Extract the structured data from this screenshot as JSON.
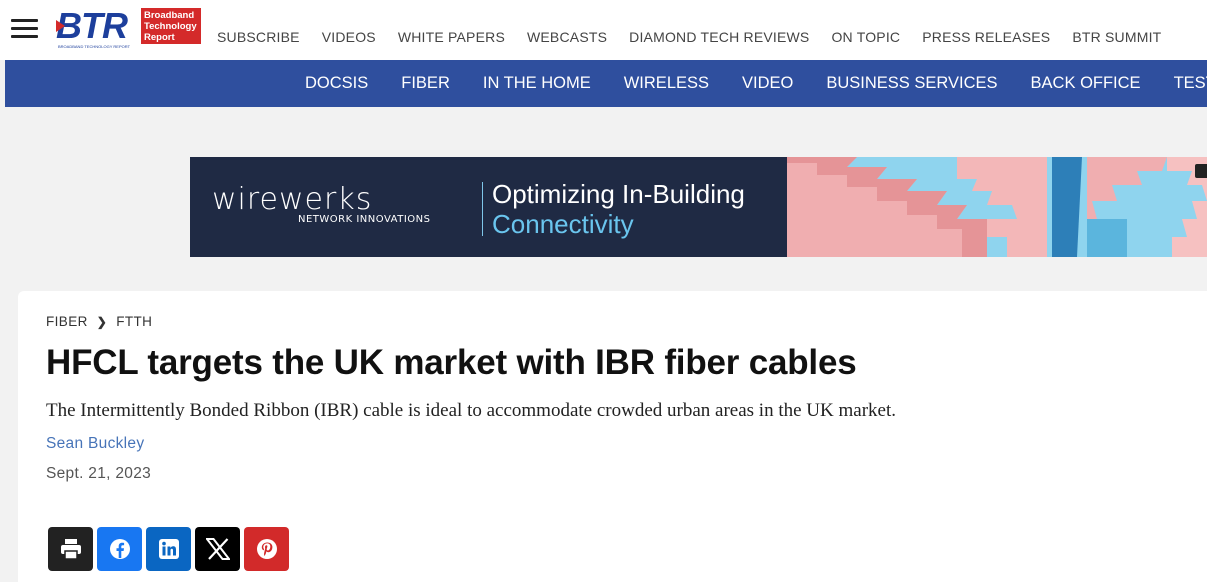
{
  "header": {
    "menu_icon": "hamburger-icon",
    "logo": {
      "wordmark": "BTR",
      "box_line1": "Broadband",
      "box_line2": "Technology",
      "box_line3": "Report",
      "tagline": "BROADBAND TECHNOLOGY REPORT"
    },
    "top_links": [
      "SUBSCRIBE",
      "VIDEOS",
      "WHITE PAPERS",
      "WEBCASTS",
      "DIAMOND TECH REVIEWS",
      "ON TOPIC",
      "PRESS RELEASES",
      "BTR SUMMIT"
    ]
  },
  "main_nav": {
    "items": [
      "DOCSIS",
      "FIBER",
      "IN THE HOME",
      "WIRELESS",
      "VIDEO",
      "BUSINESS SERVICES",
      "BACK OFFICE",
      "TEST"
    ]
  },
  "ad": {
    "brand": "wirewerks",
    "brand_sub": "NETWORK INNOVATIONS",
    "headline_line1": "Optimizing In-Building",
    "headline_line2": "Connectivity",
    "close_icon": "ad-choices-icon"
  },
  "article": {
    "breadcrumb": [
      "FIBER",
      "FTTH"
    ],
    "breadcrumb_sep_icon": "chevron-right-icon",
    "title": "HFCL targets the UK market with IBR fiber cables",
    "subtitle": "The Intermittently Bonded Ribbon (IBR) cable is ideal to accommodate crowded urban areas in the UK market.",
    "author": "Sean Buckley",
    "date": "Sept. 21, 2023"
  },
  "share": {
    "buttons": [
      {
        "icon": "print-icon",
        "color": "#222222"
      },
      {
        "icon": "facebook-icon",
        "color": "#1877f2"
      },
      {
        "icon": "linkedin-icon",
        "color": "#0a66c2"
      },
      {
        "icon": "x-icon",
        "color": "#000000"
      },
      {
        "icon": "pinterest-icon",
        "color": "#d22a2a"
      }
    ]
  },
  "colors": {
    "nav_blue": "#2f4f9e",
    "logo_blue": "#1d3f9c",
    "logo_red": "#d42a2a",
    "author_link": "#4774b8",
    "ad_bg": "#1f2a44",
    "ad_accent": "#6ac5ee"
  }
}
